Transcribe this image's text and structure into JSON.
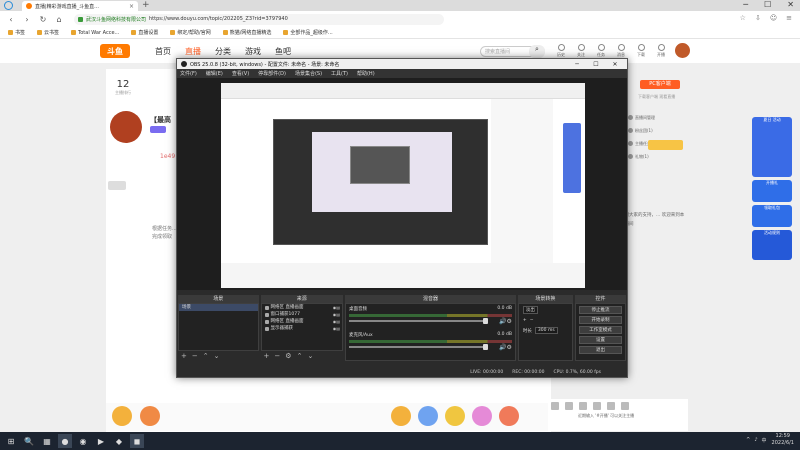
{
  "browser": {
    "tab_title": "直播|精彩游戏直播_斗鱼直...",
    "tab_close": "×",
    "new_tab": "+",
    "window_buttons": [
      "─",
      "☐",
      "✕"
    ],
    "nav_buttons": [
      "‹",
      "›",
      "↻",
      "⌂"
    ],
    "site_name": "武汉斗鱼网络科技有限公司",
    "url": "https://www.douyu.com/topic/202205_Z3?rid=3797940",
    "nav_right": [
      "☆",
      "⇩",
      "☺",
      "≡"
    ],
    "bookmarks": [
      "书签",
      "云书签",
      "Total War Acce...",
      "直播设置",
      "绑定/帮助/官网",
      "熊猫/网络直播精选",
      "全部作品_超级作..."
    ]
  },
  "site": {
    "logo_text": "斗鱼",
    "nav": [
      "首页",
      "直播",
      "分类",
      "游戏",
      "鱼吧"
    ],
    "active_nav": "直播",
    "search_placeholder": "搜索直播间",
    "header_icons": [
      "历史",
      "关注",
      "任务",
      "消息",
      "下载",
      "开播"
    ],
    "room_stat_num": "12",
    "room_stat_label": "主播排行",
    "room_title": "【最高",
    "fan_badge": "1e49",
    "side_text": "根据任务...\n完成领取",
    "pc_client": "PC客户端",
    "pc_sub": "下载客户端 观看直播",
    "right_list": [
      "直播间管理",
      "粉丝团(1)",
      "主播任务(1)",
      "礼物(1)"
    ],
    "chat_text": "感谢大家的支持，... 欢迎来到本直播间",
    "promo": [
      "夏日 活动",
      "开播礼",
      "领取礼包",
      "活动规则"
    ],
    "rec_text": "近期输入 '#开播' 可以关注主播"
  },
  "obs": {
    "title": "OBS 25.0.8 (32-bit, windows) - 配置文件: 未命名 - 场景: 未命名",
    "menu": [
      "文件(F)",
      "编辑(E)",
      "查看(V)",
      "停靠部件(D)",
      "场景集合(S)",
      "工具(T)",
      "帮助(H)"
    ],
    "docks": {
      "scenes": {
        "title": "场景",
        "items": [
          "场景"
        ]
      },
      "sources": {
        "title": "来源",
        "items": [
          "网络区 直播画面",
          "窗口捕获1077",
          "网络区 直播画面",
          "显示器捕获"
        ]
      },
      "mixer": {
        "title": "混音器",
        "tracks": [
          {
            "name": "桌面音频",
            "db": "0.0 dB"
          },
          {
            "name": "麦克风/Aux",
            "db": "0.0 dB"
          }
        ]
      },
      "transitions": {
        "title": "场景转换",
        "type": "淡出",
        "duration_label": "时长",
        "duration": "300 ms"
      },
      "controls": {
        "title": "控件",
        "buttons": [
          "停止推流",
          "开始录制",
          "工作室模式",
          "设置",
          "退出"
        ]
      }
    },
    "status": {
      "live": "LIVE: 00:00:00",
      "rec": "REC: 00:00:00",
      "cpu": "CPU: 0.7%, 60.00 fps"
    }
  },
  "taskbar": {
    "apps": [
      "⊞",
      "🔍",
      "▦",
      "●",
      "◉",
      "▶",
      "◆",
      "◼"
    ],
    "time": "12:59",
    "date": "2022/6/1",
    "tray": [
      "^",
      "♪",
      "中"
    ]
  }
}
